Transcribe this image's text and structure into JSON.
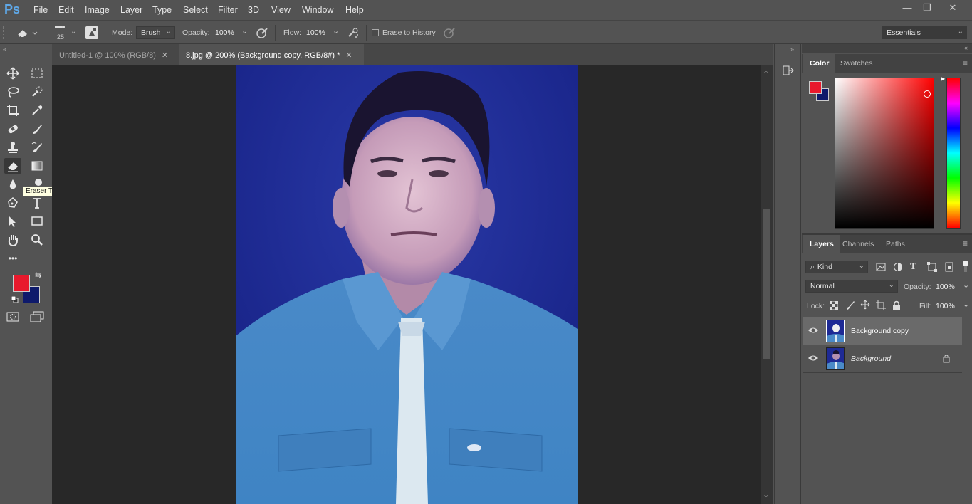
{
  "app": {
    "logo": "Ps"
  },
  "menu": [
    "File",
    "Edit",
    "Image",
    "Layer",
    "Type",
    "Select",
    "Filter",
    "3D",
    "View",
    "Window",
    "Help"
  ],
  "window_controls": {
    "minimize": "—",
    "restore": "❐",
    "close": "✕"
  },
  "options": {
    "brush_size": "25",
    "mode_label": "Mode:",
    "mode_value": "Brush",
    "opacity_label": "Opacity:",
    "opacity_value": "100%",
    "flow_label": "Flow:",
    "flow_value": "100%",
    "erase_history_label": "Erase to History",
    "workspace": "Essentials"
  },
  "tabs": [
    {
      "label": "Untitled-1 @ 100% (RGB/8)",
      "close": "✕"
    },
    {
      "label": "8.jpg @ 200% (Background copy, RGB/8#) *",
      "close": "✕"
    }
  ],
  "tooltip": "Eraser Tool (E)",
  "colors": {
    "foreground": "#e8192c",
    "background": "#0e1a6b",
    "accent": "#5fa8e8"
  },
  "color_panel": {
    "tabs": [
      "Color",
      "Swatches"
    ]
  },
  "layers_panel": {
    "tabs": [
      "Layers",
      "Channels",
      "Paths"
    ],
    "filter_kind": "Kind",
    "blend_mode": "Normal",
    "opacity_label": "Opacity:",
    "opacity_value": "100%",
    "lock_label": "Lock:",
    "fill_label": "Fill:",
    "fill_value": "100%",
    "layers": [
      {
        "name": "Background copy"
      },
      {
        "name": "Background"
      }
    ]
  }
}
